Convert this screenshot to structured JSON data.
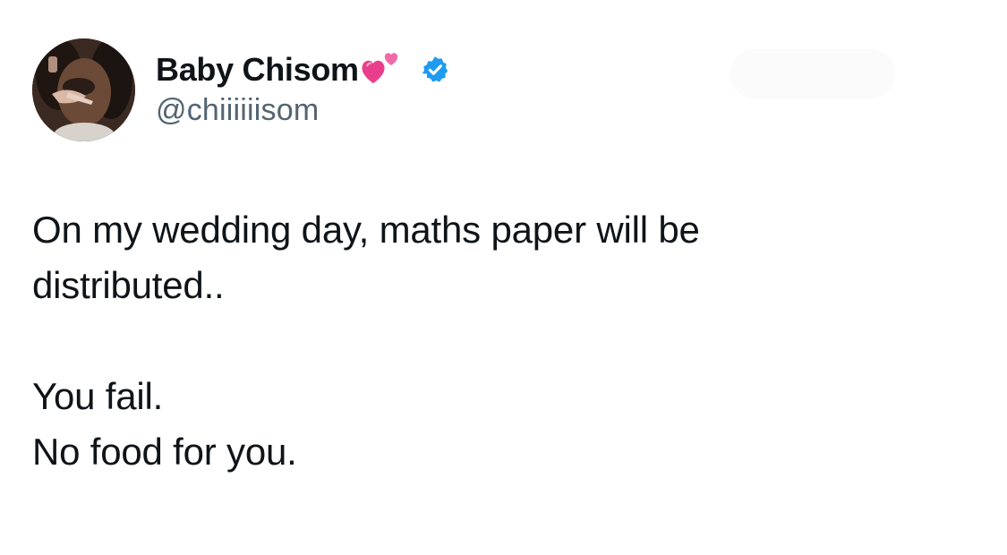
{
  "tweet": {
    "author": {
      "display_name": "Baby Chisom",
      "handle": "@chiiiiiisom",
      "name_emoji": "two-hearts-icon",
      "verified": true
    },
    "body": {
      "line1": "On my wedding day, maths paper will be",
      "line2": "distributed..",
      "line3": "You fail.",
      "line4": "No food for you."
    }
  },
  "colors": {
    "text_primary": "#0f1419",
    "text_secondary": "#536471",
    "verified_blue": "#1d9bf0",
    "heart_pink": "#e83e8c",
    "background": "#ffffff"
  }
}
